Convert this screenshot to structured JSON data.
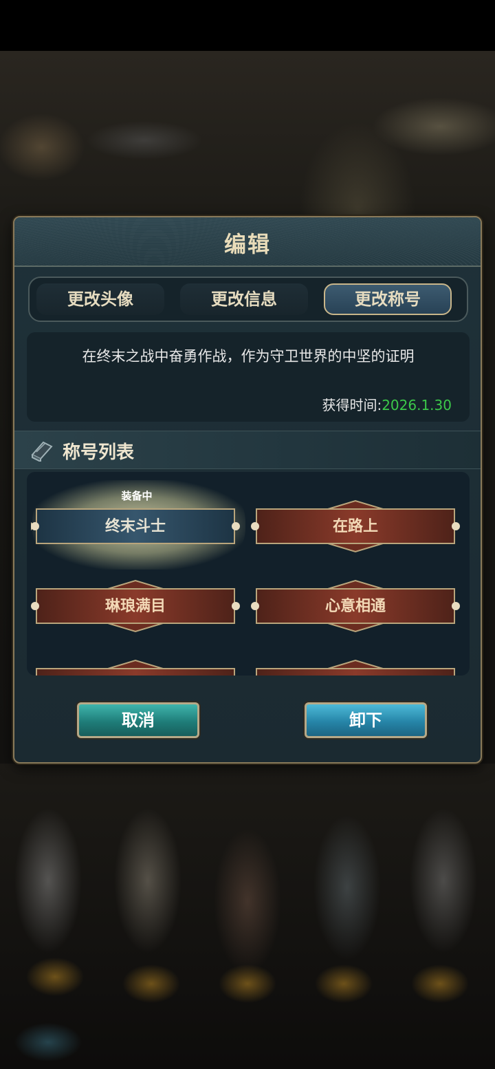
{
  "dialog": {
    "title": "编辑",
    "tabs": [
      {
        "label": "更改头像",
        "active": false
      },
      {
        "label": "更改信息",
        "active": false
      },
      {
        "label": "更改称号",
        "active": true
      }
    ],
    "description": {
      "text": "在终末之战中奋勇作战，作为守卫世界的中坚的证明",
      "acquire_label": "获得时间:",
      "acquire_date": "2026.1.30"
    },
    "section": {
      "title": "称号列表",
      "icon": "book-icon"
    },
    "titles": [
      {
        "name": "终末斗士",
        "style": "blue",
        "equipped": true
      },
      {
        "name": "在路上",
        "style": "red",
        "equipped": false
      },
      {
        "name": "琳琅满目",
        "style": "red",
        "equipped": false
      },
      {
        "name": "心意相通",
        "style": "red",
        "equipped": false
      }
    ],
    "equipped_label": "装备中",
    "buttons": {
      "cancel": "取消",
      "unequip": "卸下"
    }
  },
  "colors": {
    "accent_gold": "#c9b68a",
    "date_green": "#3cc84a",
    "badge_red": "#7a3325",
    "badge_blue": "#2d4a5e"
  }
}
